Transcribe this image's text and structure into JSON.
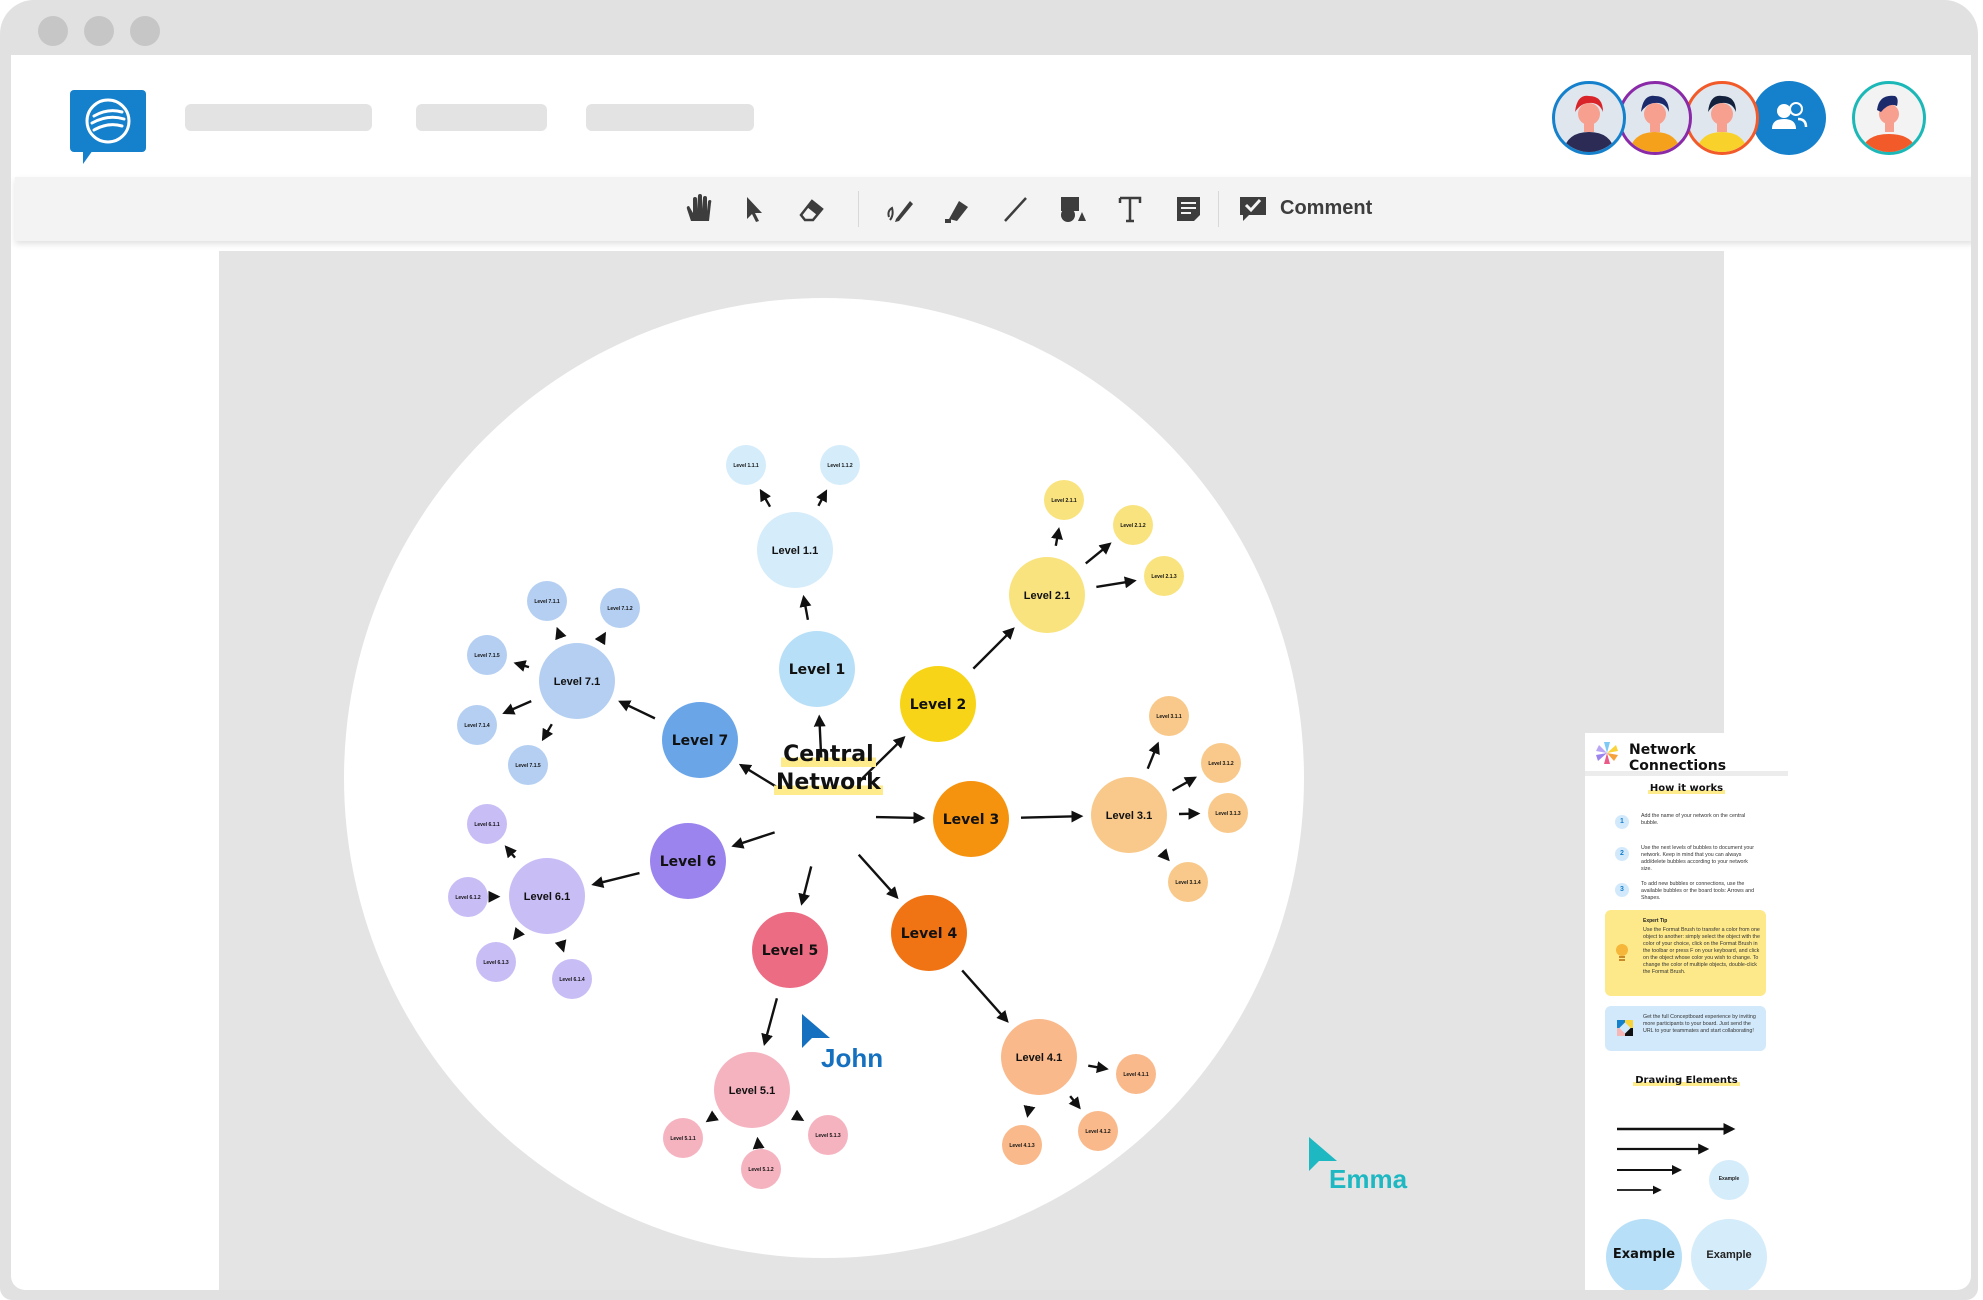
{
  "window": {
    "traffic_lights": [
      "close",
      "minimize",
      "maximize"
    ]
  },
  "header": {
    "logo_icon": "conceptboard-logo-icon",
    "nav_placeholders": 3,
    "collaborators": [
      {
        "name": "collaborator-1",
        "ring": "#1580cc",
        "hair": "#d9252a",
        "shirt": "#2b2b55"
      },
      {
        "name": "collaborator-2",
        "ring": "#8a2aa8",
        "hair": "#1b2a6b",
        "shirt": "#f6a11c"
      },
      {
        "name": "collaborator-3",
        "ring": "#f25a2a",
        "hair": "#14213d",
        "shirt": "#f8d12a"
      }
    ],
    "participants_icon": "participants-icon",
    "participants_color": "#1580cc",
    "current_user": {
      "ring": "#1cb8b8",
      "hair": "#1b2a6b",
      "shirt": "#f25a2a"
    }
  },
  "toolbar": {
    "tools": [
      {
        "id": "hand",
        "icon": "hand-icon",
        "glyph": "✋"
      },
      {
        "id": "select",
        "icon": "pointer-icon",
        "glyph": "➤"
      },
      {
        "id": "eraser",
        "icon": "eraser-icon",
        "glyph": "⌫"
      },
      {
        "id": "pen",
        "icon": "pen-icon",
        "glyph": "✎"
      },
      {
        "id": "marker",
        "icon": "marker-icon",
        "glyph": "◆"
      },
      {
        "id": "line",
        "icon": "line-icon",
        "glyph": "╱"
      },
      {
        "id": "shapes",
        "icon": "shapes-icon",
        "glyph": "●"
      },
      {
        "id": "text",
        "icon": "text-icon",
        "glyph": "T"
      },
      {
        "id": "sticky",
        "icon": "sticky-note-icon",
        "glyph": "▤"
      }
    ],
    "comment_label": "Comment"
  },
  "mindmap": {
    "center": "Central\nNetwork",
    "center_lines": [
      "Central",
      "Network"
    ],
    "colors": {
      "l1": {
        "main": "#b7dff7",
        "sub": "#d5ecfa"
      },
      "l2": {
        "main": "#f7d417",
        "sub": "#f9e37e"
      },
      "l3": {
        "main": "#f5930f",
        "sub": "#f8c98a"
      },
      "l4": {
        "main": "#f07314",
        "sub": "#f9b98a"
      },
      "l5": {
        "main": "#ec6c83",
        "sub": "#f5b3c0"
      },
      "l6": {
        "main": "#9b84ee",
        "sub": "#c9bdf5"
      },
      "l7": {
        "main": "#6aa5e8",
        "sub": "#b4cff2"
      }
    },
    "branches": [
      {
        "label": "Level 1",
        "color_key": "l1",
        "child": "Level 1.1",
        "leaves": [
          "Level 1.1.1",
          "Level 1.1.2"
        ]
      },
      {
        "label": "Level 2",
        "color_key": "l2",
        "child": "Level 2.1",
        "leaves": [
          "Level 2.1.1",
          "Level 2.1.2",
          "Level 2.1.3"
        ]
      },
      {
        "label": "Level 3",
        "color_key": "l3",
        "child": "Level 3.1",
        "leaves": [
          "Level 3.1.1",
          "Level 3.1.2",
          "Level 3.1.3",
          "Level 3.1.4"
        ]
      },
      {
        "label": "Level 4",
        "color_key": "l4",
        "child": "Level 4.1",
        "leaves": [
          "Level 4.1.1",
          "Level 4.1.2",
          "Level 4.1.3"
        ]
      },
      {
        "label": "Level 5",
        "color_key": "l5",
        "child": "Level 5.1",
        "leaves": [
          "Level 5.1.1",
          "Level 5.1.2",
          "Level 5.1.3"
        ]
      },
      {
        "label": "Level 6",
        "color_key": "l6",
        "child": "Level 6.1",
        "leaves": [
          "Level 6.1.1",
          "Level 6.1.2",
          "Level 6.1.3",
          "Level 6.1.4"
        ]
      },
      {
        "label": "Level 7",
        "color_key": "l7",
        "child": "Level 7.1",
        "leaves": [
          "Level 7.1.1",
          "Level 7.1.2",
          "Level 7.1.5",
          "Level 7.1.4",
          "Level 7.1.5"
        ]
      }
    ]
  },
  "panel": {
    "title": "Network Connections",
    "how_title": "How it works",
    "steps": [
      {
        "num": "1",
        "text": "Add the name of your network on the central bubble."
      },
      {
        "num": "2",
        "text": "Use the next levels of bubbles to document your network. Keep in mind that you can always add/delete bubbles according to your network size."
      },
      {
        "num": "3",
        "text": "To add new bubbles or connections, use the available bubbles  or the board tools: Arrows and Shapes."
      }
    ],
    "tip_title": "Expert Tip",
    "tip_text": "Use the Format Brush to transfer a color from one object to another: simply select the object with the color of your choice, click on the Format Brush in the toolbar or press F on your keyboard, and click on the object whose color you wish to change. To change the color of multiple objects, double-click the Format Brush.",
    "invite_text": "Get the full Conceptboard experience by inviting more participants to your board. Just send the URL to your teammates and start collaborating!",
    "drawing_title": "Drawing Elements",
    "example_small": "Example",
    "example_large_bold": "Example",
    "example_large": "Example"
  },
  "cursors": [
    {
      "name": "John",
      "color": "#1570bf"
    },
    {
      "name": "Emma",
      "color": "#1db8c2"
    }
  ]
}
